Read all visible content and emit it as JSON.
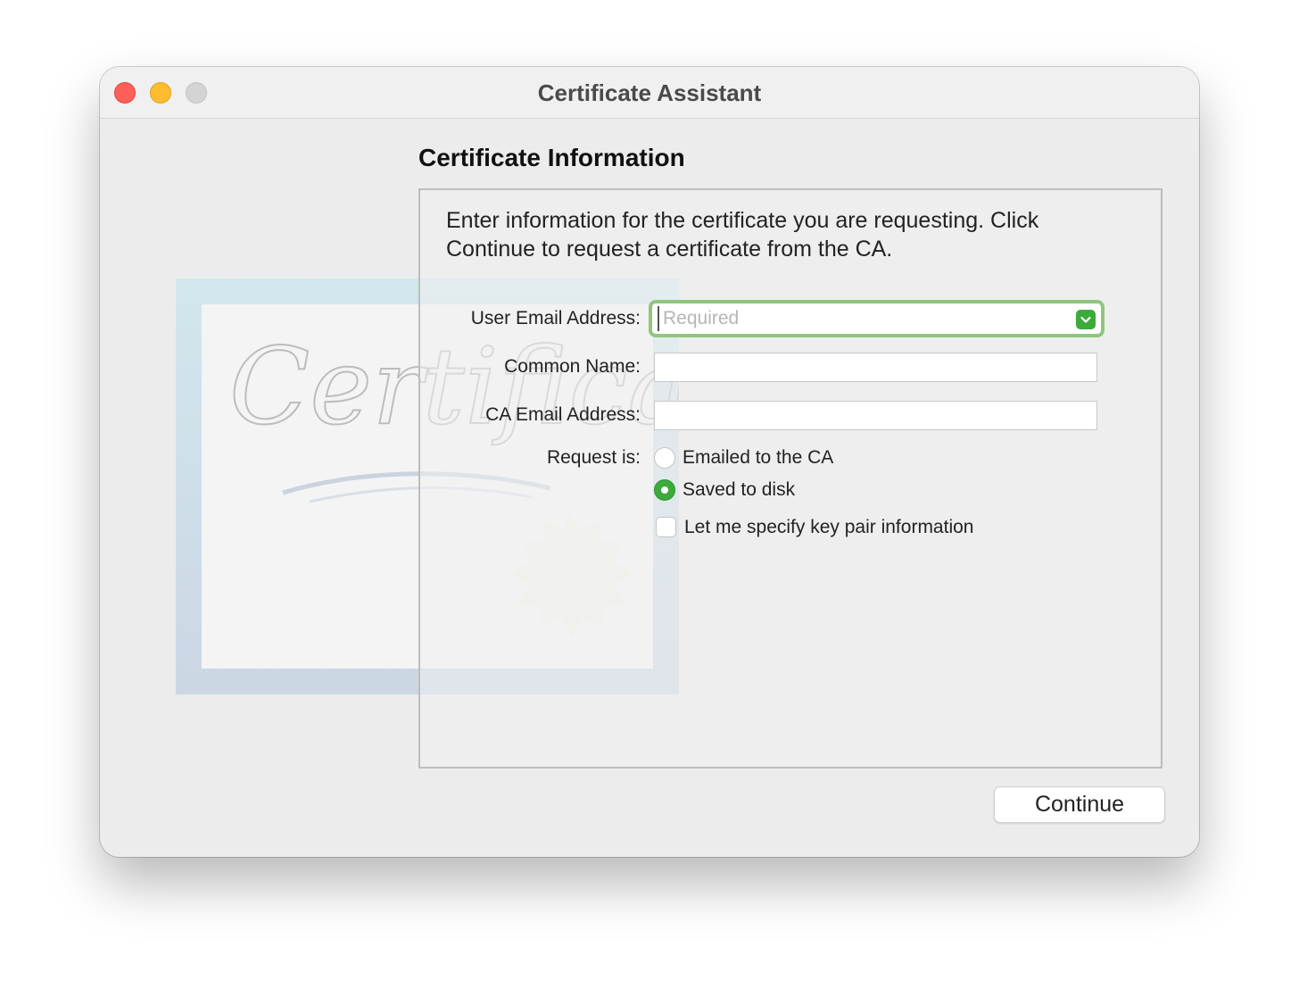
{
  "window": {
    "title": "Certificate Assistant"
  },
  "page": {
    "heading": "Certificate Information",
    "intro": "Enter information for the certificate you are requesting. Click Continue to request a certificate from the CA."
  },
  "form": {
    "user_email": {
      "label": "User Email Address:",
      "placeholder": "Required",
      "value": ""
    },
    "common_name": {
      "label": "Common Name:",
      "value": ""
    },
    "ca_email": {
      "label": "CA Email Address:",
      "value": ""
    },
    "request": {
      "label": "Request is:",
      "options": [
        {
          "label": "Emailed to the CA",
          "selected": false
        },
        {
          "label": "Saved to disk",
          "selected": true
        }
      ]
    },
    "key_pair_checkbox": {
      "label": "Let me specify key pair information",
      "checked": false
    }
  },
  "buttons": {
    "continue": "Continue"
  },
  "watermark": {
    "text": "Certificate"
  },
  "colors": {
    "accent": "#3daa3c",
    "focus_ring": "#8fc67e",
    "close": "#fe5f57",
    "minimize": "#febc2e",
    "zoom": "#d4d4d4"
  }
}
